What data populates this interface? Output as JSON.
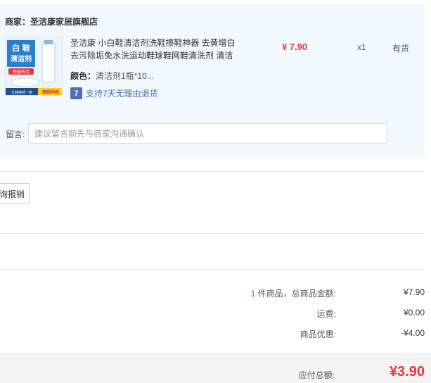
{
  "store": {
    "merchant_label": "商家：",
    "merchant_name": "圣洁康家居旗舰店"
  },
  "item": {
    "thumb_text_main": "白 鞋\n清洁剂",
    "thumb_banner": "快速去污",
    "thumb_footer_left": "让鞋焕然一新",
    "thumb_footer_right": "擦鞋神器",
    "title": "圣洁康 小白鞋清洁剂洗鞋擦鞋神器 去黄增白去污除垢免水洗运动鞋球鞋网鞋清洗剂 清洁",
    "attr_key": "颜色：",
    "attr_value": "清洁剂1瓶*10...",
    "return_badge": "7",
    "return_text": "支持7天无理由退货",
    "price": "¥ 7.90",
    "quantity": "x1",
    "stock": "有货"
  },
  "message": {
    "label": "留言:",
    "placeholder": "建议留言前先与商家沟通确认"
  },
  "invoice": {
    "button_label": "询报销"
  },
  "summary": {
    "count": "1",
    "goods_label": " 件商品，总商品金额:",
    "goods_value": "¥7.90",
    "shipping_label": "运费:",
    "shipping_value": "¥0.00",
    "discount_label": "商品优惠:",
    "discount_value": "-¥4.00",
    "total_label": "应付总额:",
    "total_value": "¥3.90"
  },
  "colors": {
    "accent_red": "#e4393c",
    "panel_bg": "#f2f9fe",
    "link_blue": "#4f6eb8"
  }
}
